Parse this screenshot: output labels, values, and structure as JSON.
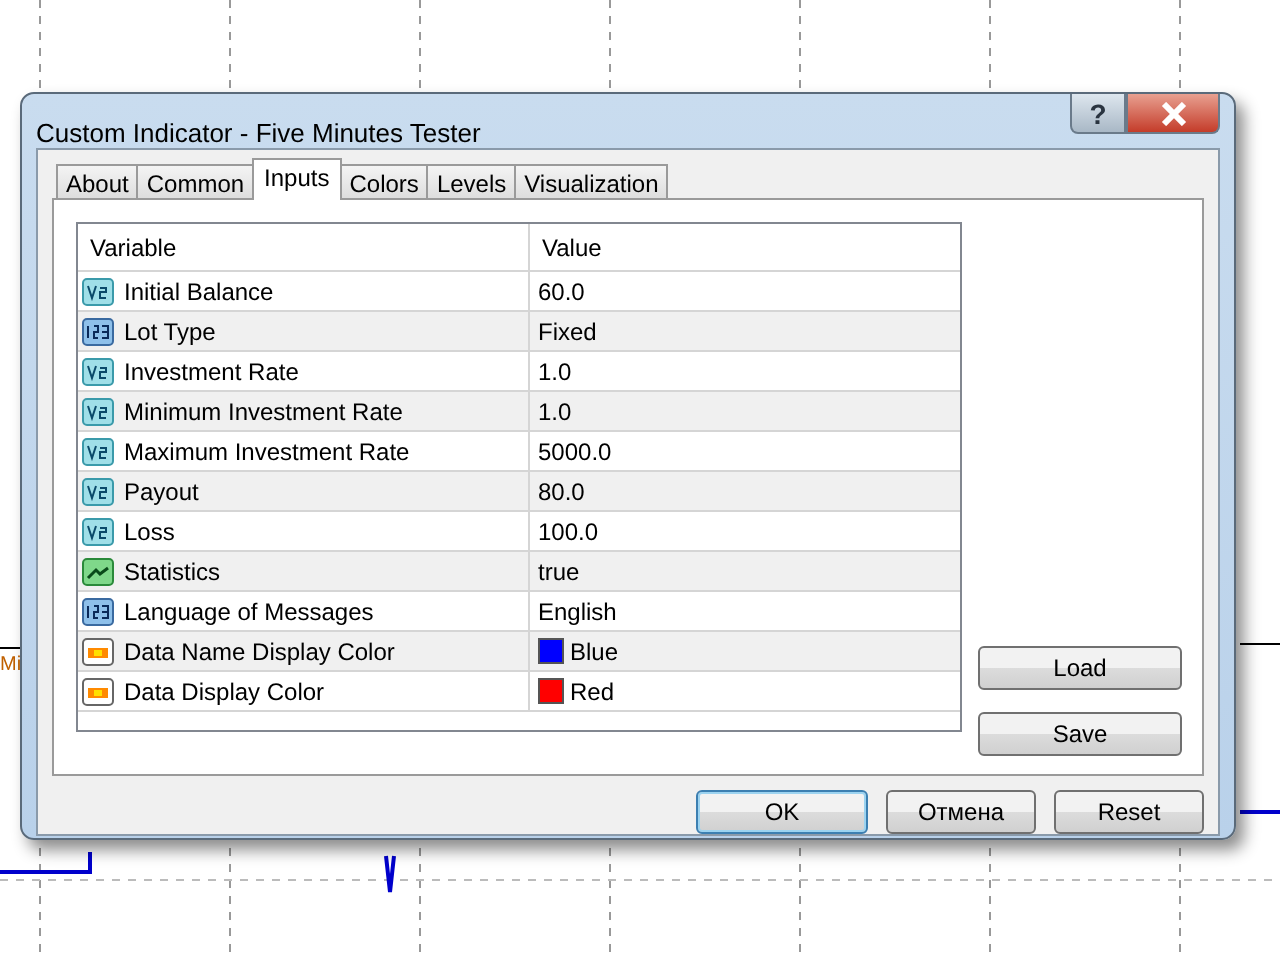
{
  "chart": {
    "label": "Mi"
  },
  "window": {
    "title": "Custom Indicator - Five Minutes Tester",
    "help": "?"
  },
  "tabs": [
    {
      "label": "About",
      "selected": false
    },
    {
      "label": "Common",
      "selected": false
    },
    {
      "label": "Inputs",
      "selected": true
    },
    {
      "label": "Colors",
      "selected": false
    },
    {
      "label": "Levels",
      "selected": false
    },
    {
      "label": "Visualization",
      "selected": false
    }
  ],
  "table": {
    "columns": [
      "Variable",
      "Value"
    ],
    "rows": [
      {
        "kind": "double",
        "variable": "Initial Balance",
        "value": "60.0"
      },
      {
        "kind": "integer",
        "variable": "Lot Type",
        "value": "Fixed"
      },
      {
        "kind": "double",
        "variable": "Investment Rate",
        "value": "1.0"
      },
      {
        "kind": "double",
        "variable": "Minimum Investment Rate",
        "value": "1.0"
      },
      {
        "kind": "double",
        "variable": "Maximum Investment Rate",
        "value": "5000.0"
      },
      {
        "kind": "double",
        "variable": "Payout",
        "value": "80.0"
      },
      {
        "kind": "double",
        "variable": "Loss",
        "value": "100.0"
      },
      {
        "kind": "boolean",
        "variable": "Statistics",
        "value": "true"
      },
      {
        "kind": "integer",
        "variable": "Language of Messages",
        "value": "English"
      },
      {
        "kind": "color",
        "variable": "Data Name Display Color",
        "value": "Blue",
        "color": "#0000ff"
      },
      {
        "kind": "color",
        "variable": "Data Display Color",
        "value": "Red",
        "color": "#ff0000"
      }
    ]
  },
  "side_buttons": [
    "Load",
    "Save"
  ],
  "buttons": [
    {
      "label": "OK",
      "default": true
    },
    {
      "label": "Отмена",
      "default": false
    },
    {
      "label": "Reset",
      "default": false
    }
  ]
}
